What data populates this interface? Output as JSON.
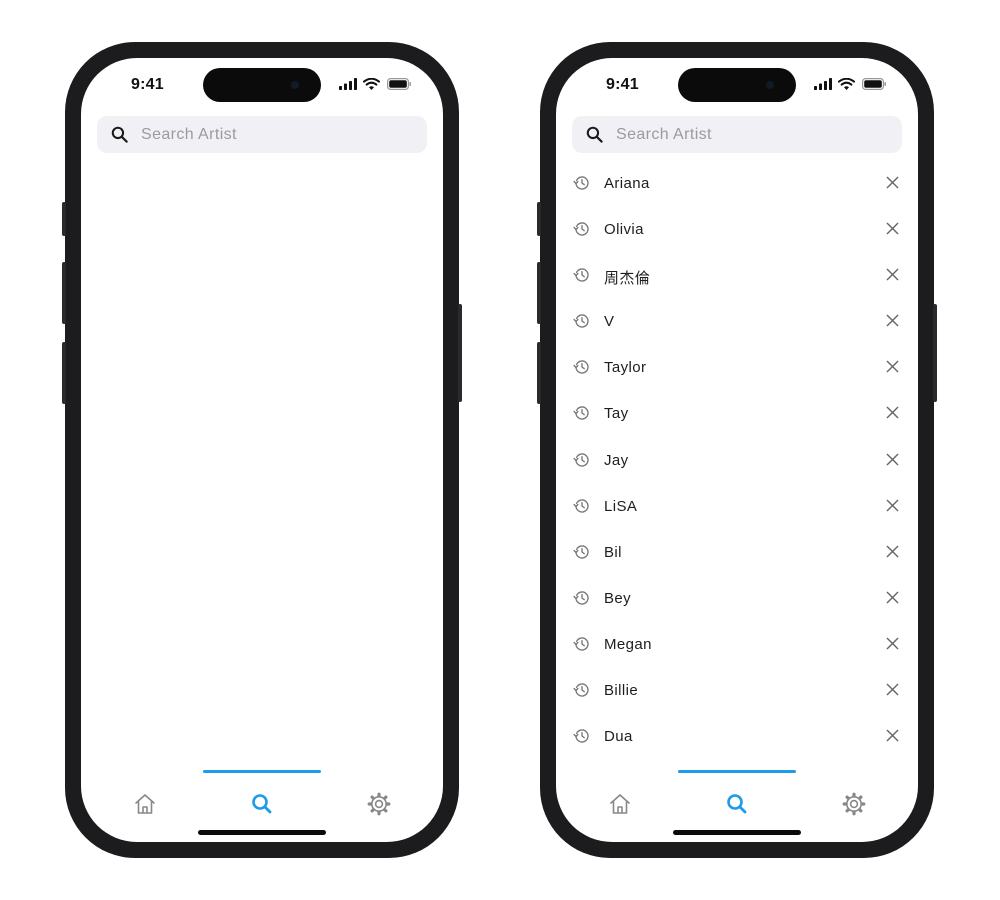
{
  "colors": {
    "accent": "#1e9be9",
    "search_field_bg": "#f1f1f5",
    "placeholder": "#9a9aa0",
    "icon_gray": "#888888"
  },
  "screens": [
    {
      "status_bar": {
        "time": "9:41"
      },
      "search": {
        "placeholder": "Search Artist",
        "value": ""
      },
      "history": [],
      "tabs": [
        {
          "icon": "home-icon",
          "active": false
        },
        {
          "icon": "search-icon",
          "active": true
        },
        {
          "icon": "gear-icon",
          "active": false
        }
      ]
    },
    {
      "status_bar": {
        "time": "9:41"
      },
      "search": {
        "placeholder": "Search Artist",
        "value": ""
      },
      "history": [
        {
          "label": "Ariana"
        },
        {
          "label": "Olivia"
        },
        {
          "label": "周杰倫"
        },
        {
          "label": "V"
        },
        {
          "label": "Taylor"
        },
        {
          "label": "Tay"
        },
        {
          "label": "Jay"
        },
        {
          "label": "LiSA"
        },
        {
          "label": "Bil"
        },
        {
          "label": "Bey"
        },
        {
          "label": "Megan"
        },
        {
          "label": "Billie"
        },
        {
          "label": "Dua"
        }
      ],
      "tabs": [
        {
          "icon": "home-icon",
          "active": false
        },
        {
          "icon": "search-icon",
          "active": true
        },
        {
          "icon": "gear-icon",
          "active": false
        }
      ]
    }
  ]
}
